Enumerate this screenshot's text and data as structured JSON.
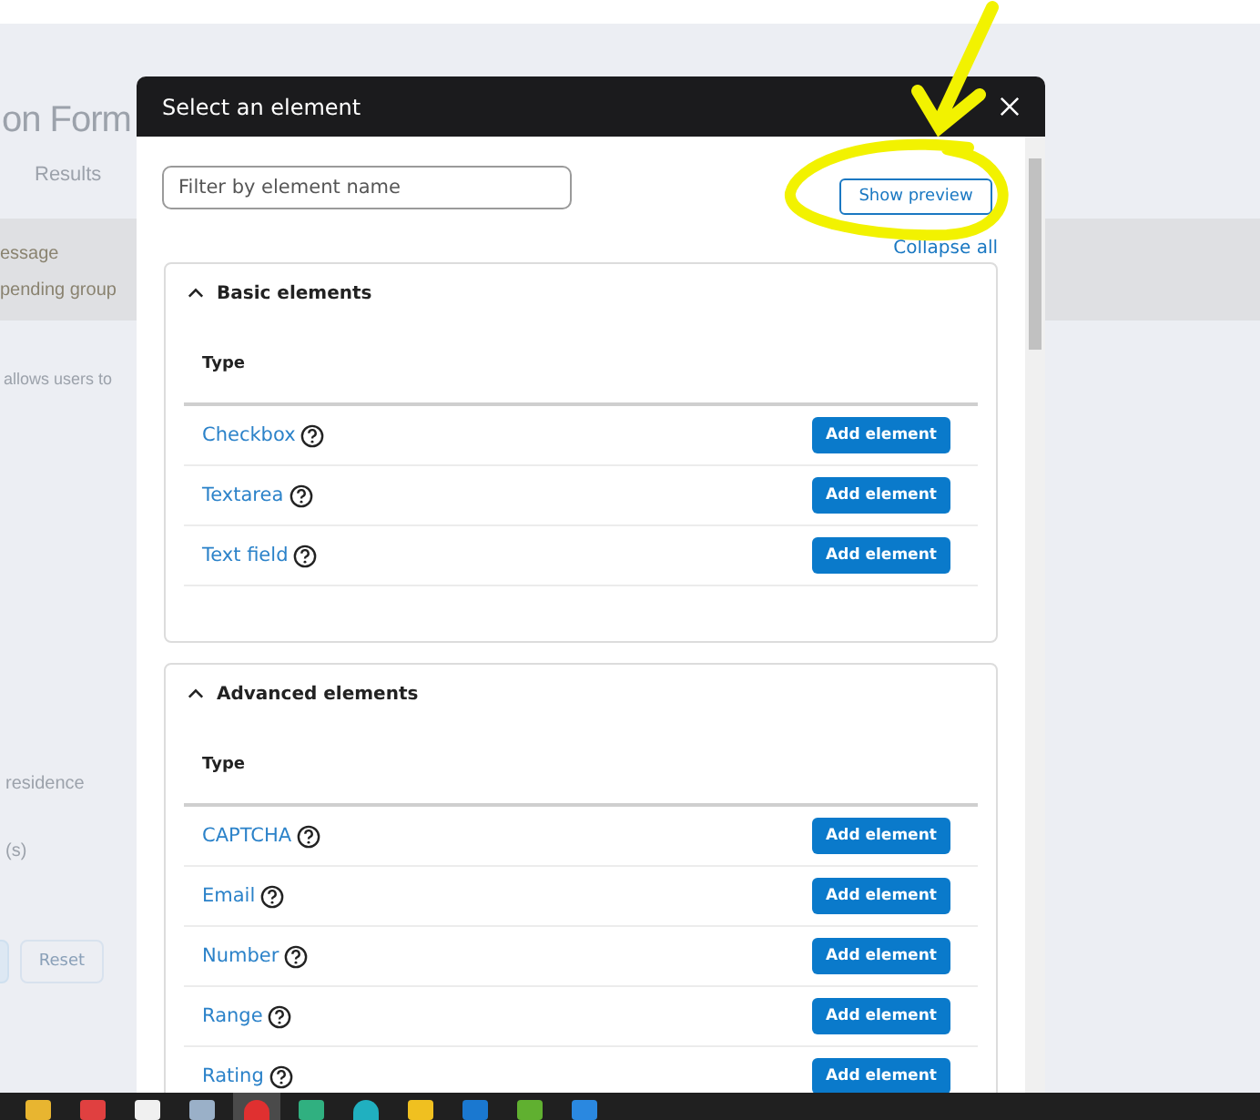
{
  "background_page": {
    "title": "on Form",
    "tab": "Results",
    "banner": [
      "essage",
      "pending group"
    ],
    "description": "allows users to",
    "field_labels": [
      "residence",
      "(s)"
    ],
    "buttons": [
      "Reset"
    ]
  },
  "dialog": {
    "title": "Select an element",
    "filter": {
      "placeholder": "Filter by element name"
    },
    "show_preview": "Show preview",
    "collapse_all": "Collapse all",
    "sections": [
      {
        "title": "Basic elements",
        "expanded": true,
        "column": "Type",
        "rows": [
          {
            "name": "Checkbox",
            "action": "Add element"
          },
          {
            "name": "Textarea",
            "action": "Add element"
          },
          {
            "name": "Text field",
            "action": "Add element"
          }
        ]
      },
      {
        "title": "Advanced elements",
        "expanded": true,
        "column": "Type",
        "rows": [
          {
            "name": "CAPTCHA",
            "action": "Add element"
          },
          {
            "name": "Email",
            "action": "Add element"
          },
          {
            "name": "Number",
            "action": "Add element"
          },
          {
            "name": "Range",
            "action": "Add element"
          },
          {
            "name": "Rating",
            "action": "Add element"
          }
        ]
      }
    ]
  }
}
